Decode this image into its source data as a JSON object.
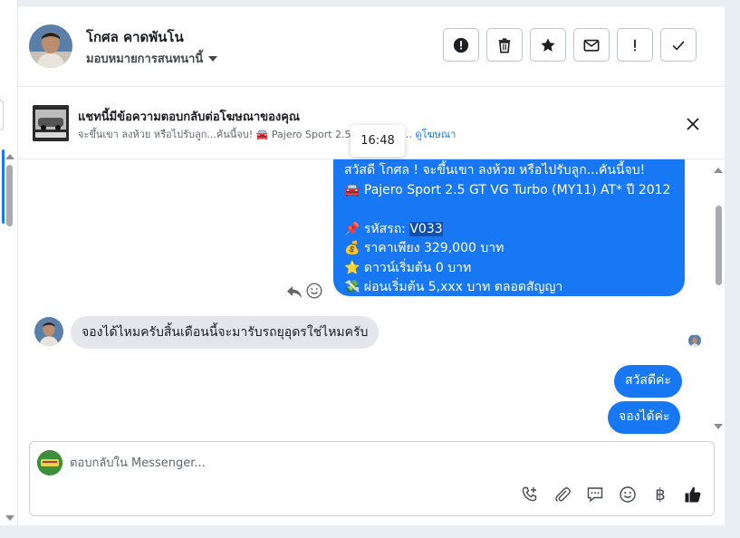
{
  "header": {
    "name": "โกศล คาดพันโน",
    "assign_label": "มอบหมายการสนทนานี้",
    "actions": [
      {
        "icon": "alert-circle-icon",
        "name": "mark-spam-button"
      },
      {
        "icon": "trash-icon",
        "name": "delete-button"
      },
      {
        "icon": "star-icon",
        "name": "star-button"
      },
      {
        "icon": "envelope-icon",
        "name": "mark-unread-button"
      },
      {
        "icon": "exclamation-icon",
        "name": "follow-up-button"
      },
      {
        "icon": "check-icon",
        "name": "mark-done-button"
      }
    ]
  },
  "ad_bar": {
    "title": "แชทนี้มีข้อความตอบกลับต่อโฆษณาของคุณ",
    "subtitle_prefix": "จะขึ้นเขา ลงห้วย หรือไปรับลูก...คันนี้จบ!",
    "subtitle_car": "🚘 Pajero Sport 2.5 GT VG Tur...",
    "link": "ดูโฆษณา"
  },
  "tooltip": {
    "time": "16:48"
  },
  "messages": {
    "outgoing_ad": {
      "line1": "สวัสดี โกศล ! จะขึ้นเขา ลงห้วย หรือไปรับลูก...คันนี้จบ!",
      "line2": "🚘 Pajero Sport 2.5 GT VG Turbo (MY11) AT* ปี 2012",
      "line3_prefix": "📌 รหัสรถ: ",
      "line3_code": "V033",
      "line4": "💰 ราคาเพียง 329,000 บาท",
      "line5": "⭐ ดาวน์เริ่มต้น 0 บาท",
      "line6": "💸 ผ่อนเริ่มต้น 5,xxx บาท ตลอดสัญญา"
    },
    "incoming_1": "จองได้ไหมครับสิ้นเดือนนี้จะมารับรถยุอุดรใช่ไหมครับ",
    "outgoing_2": "สวัสดีค่ะ",
    "outgoing_3": "จองได้ค่ะ"
  },
  "composer": {
    "placeholder": "ตอบกลับใน Messenger...",
    "currency_symbol": "฿",
    "tools": [
      "add-call-icon",
      "paperclip-icon",
      "saved-reply-icon",
      "emoji-icon",
      "baht-icon",
      "thumbs-up-icon"
    ]
  },
  "colors": {
    "accent": "#1877f2",
    "incoming_bubble": "#e4e6eb",
    "border": "#e4e6eb"
  }
}
